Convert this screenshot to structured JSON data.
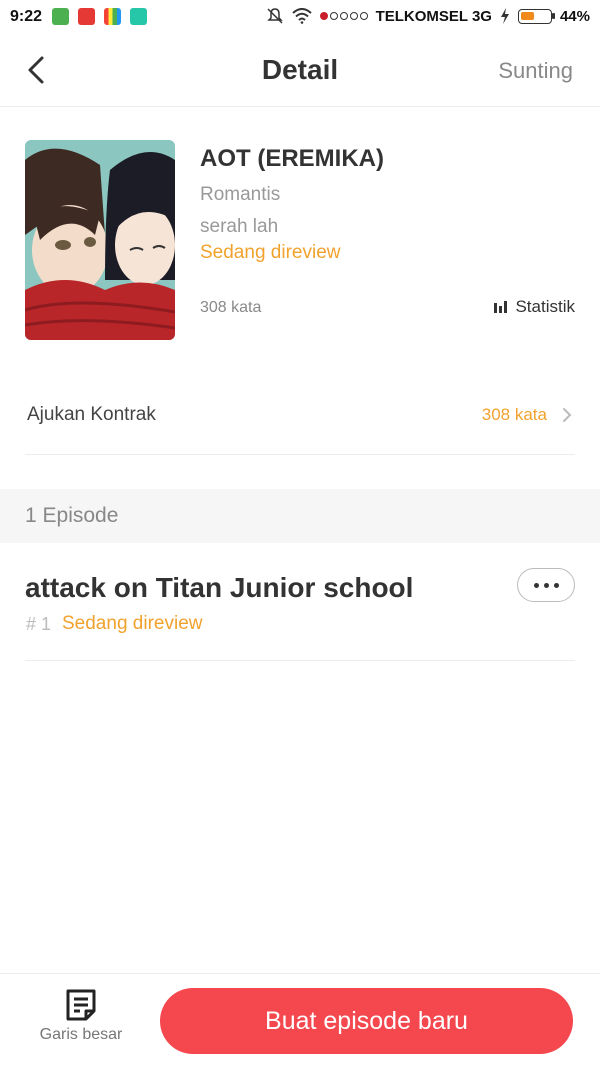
{
  "status_bar": {
    "time": "9:22",
    "carrier": "TELKOMSEL 3G",
    "battery_percent": "44%",
    "battery_level": 0.44,
    "icons": [
      "app-green-icon",
      "manga-toon-icon",
      "app-multicolor-icon",
      "app-grid-icon",
      "mute-icon",
      "wifi-icon",
      "signal-icon",
      "charging-icon",
      "battery-icon"
    ]
  },
  "header": {
    "title": "Detail",
    "edit_label": "Sunting"
  },
  "book": {
    "title": "AOT (EREMIKA)",
    "genre": "Romantis",
    "description": "serah lah",
    "status": "Sedang direview",
    "word_count": "308 kata",
    "stats_label": "Statistik"
  },
  "contract": {
    "label": "Ajukan Kontrak",
    "value": "308 kata"
  },
  "episodes": {
    "count_label": "1 Episode",
    "items": [
      {
        "title": "attack on Titan Junior school",
        "number": "# 1",
        "status": "Sedang direview"
      }
    ]
  },
  "bottom": {
    "outline_label": "Garis besar",
    "new_episode_label": "Buat episode baru"
  },
  "colors": {
    "accent_orange": "#f1a22d",
    "primary_red": "#f4474e",
    "divider": "#ececec"
  }
}
